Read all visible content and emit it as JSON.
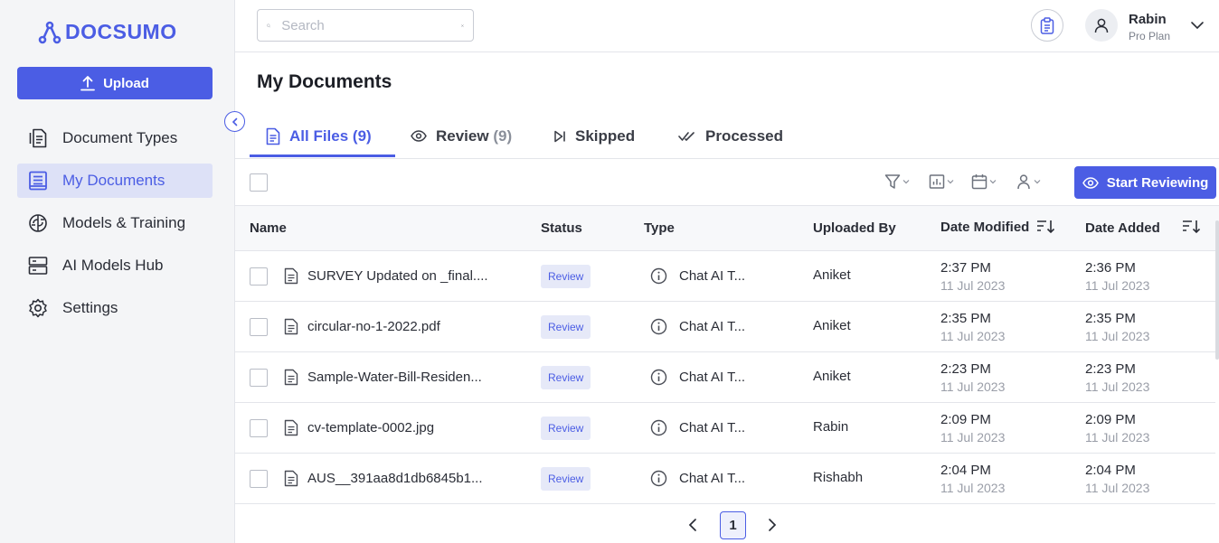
{
  "brand": {
    "name": "DOCSUMO",
    "color": "#4b5de4"
  },
  "sidebar": {
    "upload_label": "Upload",
    "items": [
      {
        "label": "Document Types",
        "icon": "document-types-icon"
      },
      {
        "label": "My Documents",
        "icon": "my-documents-icon",
        "active": true
      },
      {
        "label": "Models & Training",
        "icon": "brain-icon"
      },
      {
        "label": "AI Models Hub",
        "icon": "server-icon"
      },
      {
        "label": "Settings",
        "icon": "gear-icon"
      }
    ]
  },
  "header": {
    "search_placeholder": "Search",
    "user": {
      "name": "Rabin",
      "plan": "Pro Plan"
    }
  },
  "main": {
    "title": "My Documents",
    "tabs": [
      {
        "label": "All Files",
        "count": "(9)",
        "active": true
      },
      {
        "label": "Review",
        "count": "(9)"
      },
      {
        "label": "Skipped",
        "count": ""
      },
      {
        "label": "Processed",
        "count": ""
      }
    ],
    "start_reviewing_label": "Start Reviewing",
    "columns": {
      "name": "Name",
      "status": "Status",
      "type": "Type",
      "uploaded_by": "Uploaded By",
      "date_modified": "Date Modified",
      "date_added": "Date Added"
    },
    "rows": [
      {
        "name": "SURVEY Updated on _final....",
        "status": "Review",
        "type": "Chat AI T...",
        "uploaded_by": "Aniket",
        "modified_time": "2:37 PM",
        "modified_date": "11 Jul 2023",
        "added_time": "2:36 PM",
        "added_date": "11 Jul 2023"
      },
      {
        "name": "circular-no-1-2022.pdf",
        "status": "Review",
        "type": "Chat AI T...",
        "uploaded_by": "Aniket",
        "modified_time": "2:35 PM",
        "modified_date": "11 Jul 2023",
        "added_time": "2:35 PM",
        "added_date": "11 Jul 2023"
      },
      {
        "name": "Sample-Water-Bill-Residen...",
        "status": "Review",
        "type": "Chat AI T...",
        "uploaded_by": "Aniket",
        "modified_time": "2:23 PM",
        "modified_date": "11 Jul 2023",
        "added_time": "2:23 PM",
        "added_date": "11 Jul 2023"
      },
      {
        "name": "cv-template-0002.jpg",
        "status": "Review",
        "type": "Chat AI T...",
        "uploaded_by": "Rabin",
        "modified_time": "2:09 PM",
        "modified_date": "11 Jul 2023",
        "added_time": "2:09 PM",
        "added_date": "11 Jul 2023"
      },
      {
        "name": "AUS__391aa8d1db6845b1...",
        "status": "Review",
        "type": "Chat AI T...",
        "uploaded_by": "Rishabh",
        "modified_time": "2:04 PM",
        "modified_date": "11 Jul 2023",
        "added_time": "2:04 PM",
        "added_date": "11 Jul 2023"
      }
    ],
    "pagination": {
      "current_page": "1"
    }
  }
}
